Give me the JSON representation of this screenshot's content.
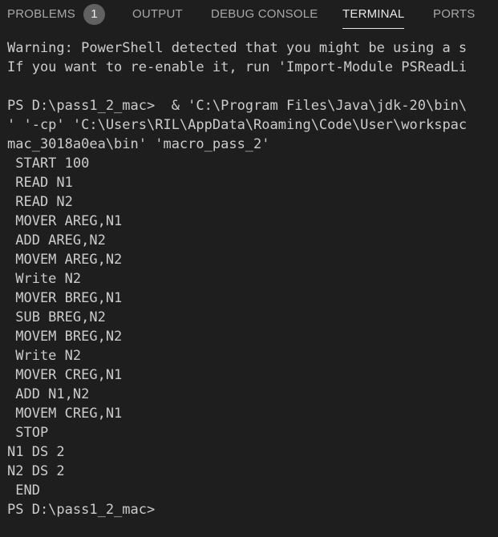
{
  "tabs": {
    "problems": {
      "label": "PROBLEMS",
      "count": "1"
    },
    "output": {
      "label": "OUTPUT"
    },
    "debug_console": {
      "label": "DEBUG CONSOLE"
    },
    "terminal": {
      "label": "TERMINAL"
    },
    "ports": {
      "label": "PORTS"
    }
  },
  "terminal": {
    "lines": [
      "Warning: PowerShell detected that you might be using a s",
      "If you want to re-enable it, run 'Import-Module PSReadLi",
      "",
      "PS D:\\pass1_2_mac>  & 'C:\\Program Files\\Java\\jdk-20\\bin\\",
      "' '-cp' 'C:\\Users\\RIL\\AppData\\Roaming\\Code\\User\\workspac",
      "mac_3018a0ea\\bin' 'macro_pass_2'",
      " START 100",
      " READ N1",
      " READ N2",
      " MOVER AREG,N1",
      " ADD AREG,N2",
      " MOVEM AREG,N2",
      " Write N2",
      " MOVER BREG,N1",
      " SUB BREG,N2",
      " MOVEM BREG,N2",
      " Write N2",
      " MOVER CREG,N1",
      " ADD N1,N2",
      " MOVEM CREG,N1",
      " STOP",
      "N1 DS 2",
      "N2 DS 2",
      " END",
      "PS D:\\pass1_2_mac>"
    ]
  },
  "colors": {
    "background": "#1e1e1e",
    "terminal_text": "#cccccc",
    "tab_inactive": "#a8a8a8",
    "tab_active": "#e7e7e7",
    "badge_bg": "#616161"
  }
}
